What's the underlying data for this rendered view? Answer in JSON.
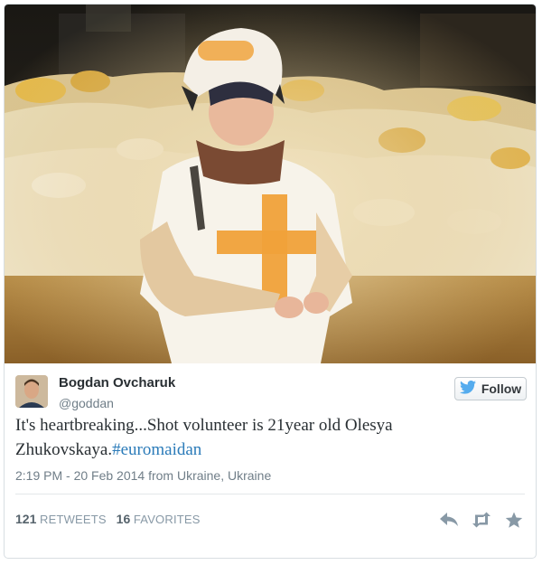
{
  "user": {
    "name": "Bogdan Ovcharuk",
    "handle": "@goddan"
  },
  "follow_button": {
    "label": "Follow",
    "icon": "twitter-bird-icon"
  },
  "tweet": {
    "text": "It's heartbreaking...Shot volunteer is 21year old Olesya Zhukovskaya.",
    "hashtag": "#euromaidan",
    "timestamp": "2:19 PM - 20 Feb 2014 from Ukraine, Ukraine"
  },
  "stats": {
    "retweets_count": "121",
    "retweets_label": "RETWEETS",
    "favorites_count": "16",
    "favorites_label": "FAVORITES"
  },
  "actions": [
    "reply-icon",
    "retweet-icon",
    "favorite-star-icon"
  ],
  "colors": {
    "link": "#2b7bb9",
    "twitter_blue": "#55acee",
    "muted_text": "#707e88"
  }
}
